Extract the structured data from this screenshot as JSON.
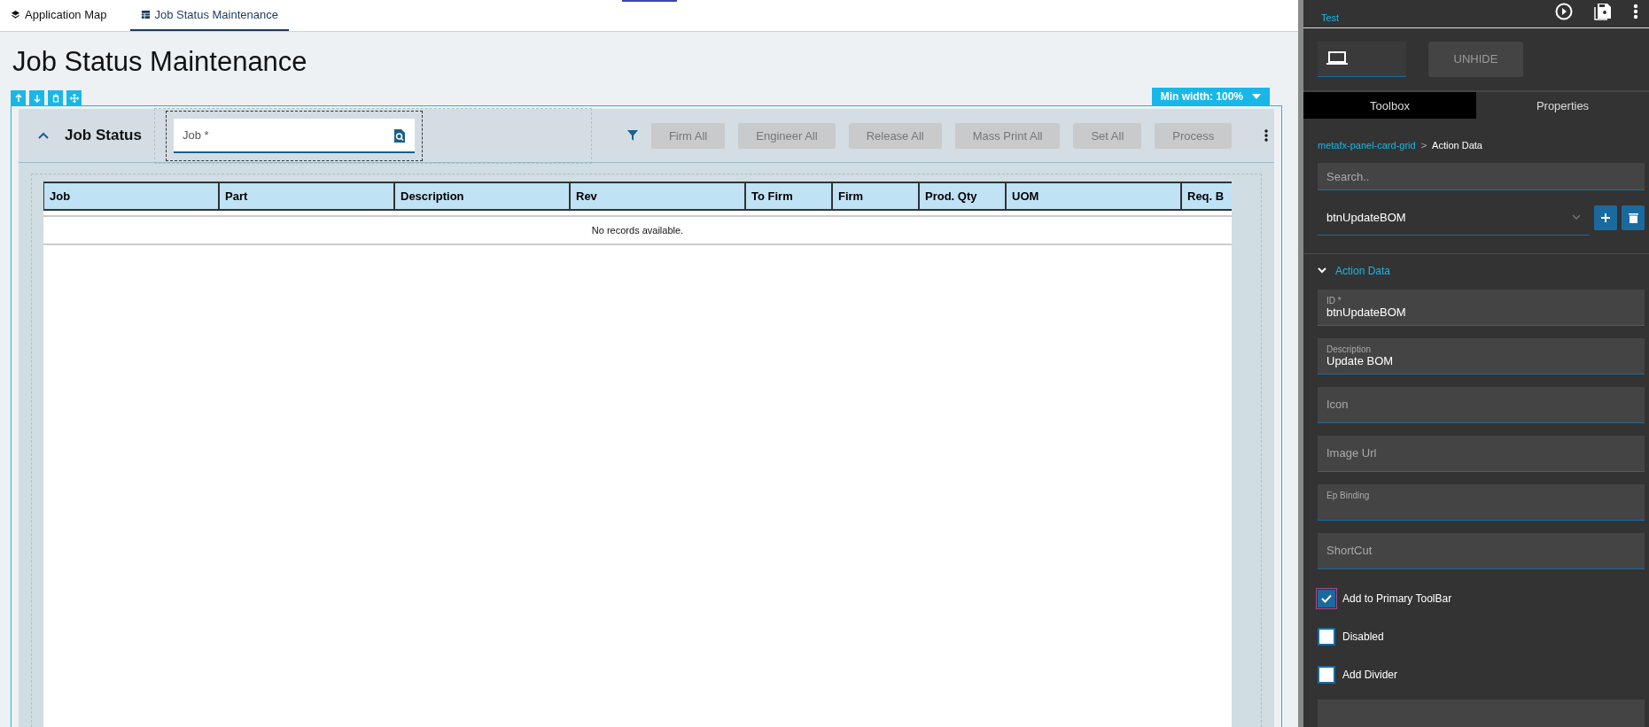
{
  "tabs": [
    {
      "label": "Application Map",
      "selected": false
    },
    {
      "label": "Job Status Maintenance",
      "selected": true
    }
  ],
  "page_title": "Job Status Maintenance",
  "card": {
    "title": "Job Status",
    "expanded": true,
    "min_width": "Min width: 100%",
    "job_field": {
      "placeholder": "Job *"
    },
    "actions": [
      {
        "label": "Firm All",
        "disabled": true
      },
      {
        "label": "Engineer All",
        "disabled": true
      },
      {
        "label": "Release All",
        "disabled": true
      },
      {
        "label": "Mass Print All",
        "disabled": true
      },
      {
        "label": "Set All",
        "disabled": true
      },
      {
        "label": "Process",
        "disabled": true
      }
    ],
    "grid": {
      "columns": [
        "Job",
        "Part",
        "Description",
        "Rev",
        "To Firm",
        "Firm",
        "Prod. Qty",
        "UOM",
        "Req. B"
      ],
      "empty_message": "No records available."
    }
  },
  "designer": {
    "subtitle": "Test",
    "unhide": "UNHIDE",
    "tabs": [
      {
        "label": "Toolbox",
        "selected": true
      },
      {
        "label": "Properties",
        "selected": false
      }
    ],
    "breadcrumb": {
      "parent": "metafx-panel-card-grid",
      "separator": ">",
      "current": "Action Data"
    },
    "search": {
      "placeholder": "Search.."
    },
    "action_select": {
      "value": "btnUpdateBOM"
    },
    "section": {
      "title": "Action Data",
      "expanded": true
    },
    "fields": [
      {
        "label": "ID *",
        "value": "btnUpdateBOM"
      },
      {
        "label": "Description",
        "value": "Update BOM"
      },
      {
        "placeholder": "Icon"
      },
      {
        "placeholder": "Image Url"
      },
      {
        "label": "Ep Binding"
      },
      {
        "placeholder": "ShortCut"
      }
    ],
    "checkboxes": [
      {
        "label": "Add to Primary ToolBar",
        "checked": true
      },
      {
        "label": "Disabled",
        "checked": false
      },
      {
        "label": "Add Divider",
        "checked": false
      }
    ]
  }
}
